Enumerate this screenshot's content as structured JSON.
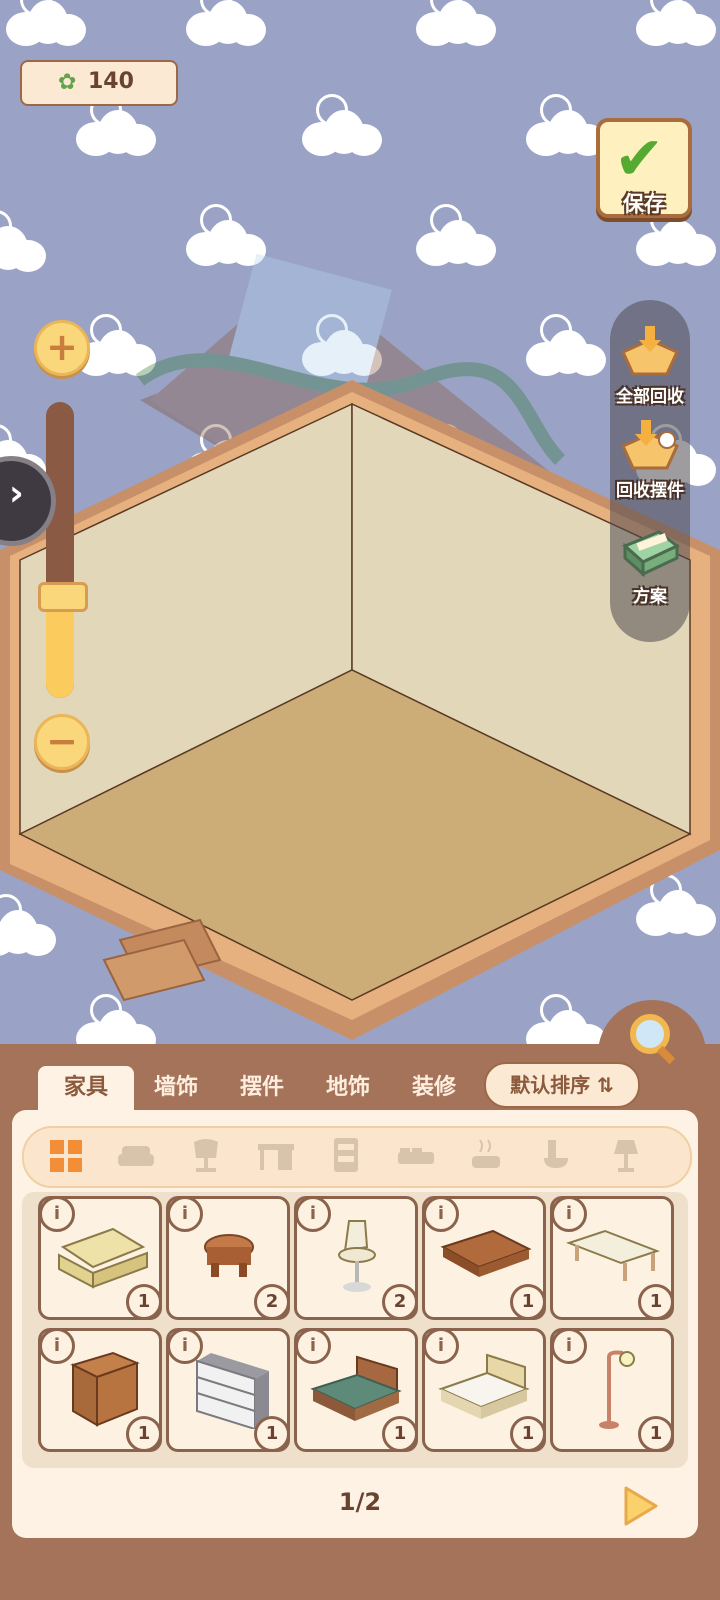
{
  "currency": {
    "icon": "clover-icon",
    "amount": "140"
  },
  "save": {
    "label": "保存"
  },
  "side_actions": [
    {
      "label": "全部回收",
      "icon": "recycle-all-icon"
    },
    {
      "label": "回收摆件",
      "icon": "recycle-ornament-icon"
    },
    {
      "label": "方案",
      "icon": "blueprint-icon"
    }
  ],
  "zoom": {
    "plus": "+",
    "minus": "−",
    "level": 0.35
  },
  "tabs": [
    {
      "label": "家具",
      "active": true
    },
    {
      "label": "墙饰",
      "active": false
    },
    {
      "label": "摆件",
      "active": false
    },
    {
      "label": "地饰",
      "active": false
    },
    {
      "label": "装修",
      "active": false
    }
  ],
  "sort": {
    "label": "默认排序 ⇅"
  },
  "categories": [
    "grid-all-icon",
    "sofa-icon",
    "chair-icon",
    "desk-icon",
    "cabinet-icon",
    "bed-icon",
    "pot-icon",
    "toilet-icon",
    "lamp-icon"
  ],
  "items": [
    {
      "name": "sofa",
      "count": "1",
      "info": "i"
    },
    {
      "name": "round-stool",
      "count": "2",
      "info": "i"
    },
    {
      "name": "bar-chair",
      "count": "2",
      "info": "i"
    },
    {
      "name": "coffee-table",
      "count": "1",
      "info": "i"
    },
    {
      "name": "low-table",
      "count": "1",
      "info": "i"
    },
    {
      "name": "wood-cabinet",
      "count": "1",
      "info": "i"
    },
    {
      "name": "drawer-chest",
      "count": "1",
      "info": "i"
    },
    {
      "name": "green-bed",
      "count": "1",
      "info": "i"
    },
    {
      "name": "white-bed",
      "count": "1",
      "info": "i"
    },
    {
      "name": "floor-lamp",
      "count": "1",
      "info": "i"
    }
  ],
  "pagination": {
    "label": "1/2"
  },
  "colors": {
    "background": "#9aa3c6",
    "panel": "#a4735a",
    "wall": "#e2d7b8",
    "floor": "#cdad77",
    "frame": "#c89068"
  }
}
